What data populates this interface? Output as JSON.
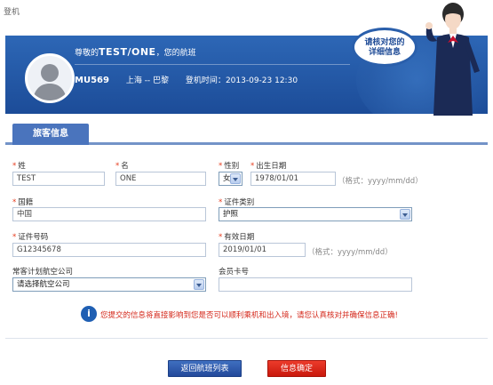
{
  "breadcrumb": "登机",
  "banner": {
    "greeting_prefix": "尊敬的",
    "passenger_name": "TEST/ONE",
    "greeting_suffix": "，您的航班",
    "flight_no": "MU569",
    "route": "上海 -- 巴黎",
    "boarding_time_label": "登机时间：",
    "boarding_time": "2013-09-23 12:30",
    "bubble_line1": "请核对您的",
    "bubble_line2": "详细信息"
  },
  "tab": {
    "label": "旅客信息"
  },
  "form": {
    "surname": {
      "label": "姓",
      "value": "TEST"
    },
    "given_name": {
      "label": "名",
      "value": "ONE"
    },
    "gender": {
      "label": "性别",
      "value": "女"
    },
    "birth_date": {
      "label": "出生日期",
      "value": "1978/01/01",
      "hint": "（格式：yyyy/mm/dd）"
    },
    "nationality": {
      "label": "国籍",
      "value": "中国"
    },
    "id_type": {
      "label": "证件类别",
      "value": "护照"
    },
    "id_number": {
      "label": "证件号码",
      "value": "G12345678"
    },
    "expiry_date": {
      "label": "有效日期",
      "value": "2019/01/01",
      "hint": "（格式：yyyy/mm/dd）"
    },
    "ffp_airline": {
      "label": "常客计划航空公司",
      "value": "请选择航空公司"
    },
    "member_card": {
      "label": "会员卡号",
      "value": ""
    },
    "required_mark": "*"
  },
  "notice": {
    "icon": "i",
    "text": "您提交的信息将直接影响到您是否可以顺利乘机和出入境，请您认真核对并确保信息正确!"
  },
  "buttons": {
    "back": "返回航班列表",
    "confirm": "信息确定"
  },
  "colors": {
    "banner": "#1c4c98",
    "tab": "#4a74bd",
    "required": "#e5391a",
    "confirm": "#c9180c",
    "back": "#23499a"
  }
}
